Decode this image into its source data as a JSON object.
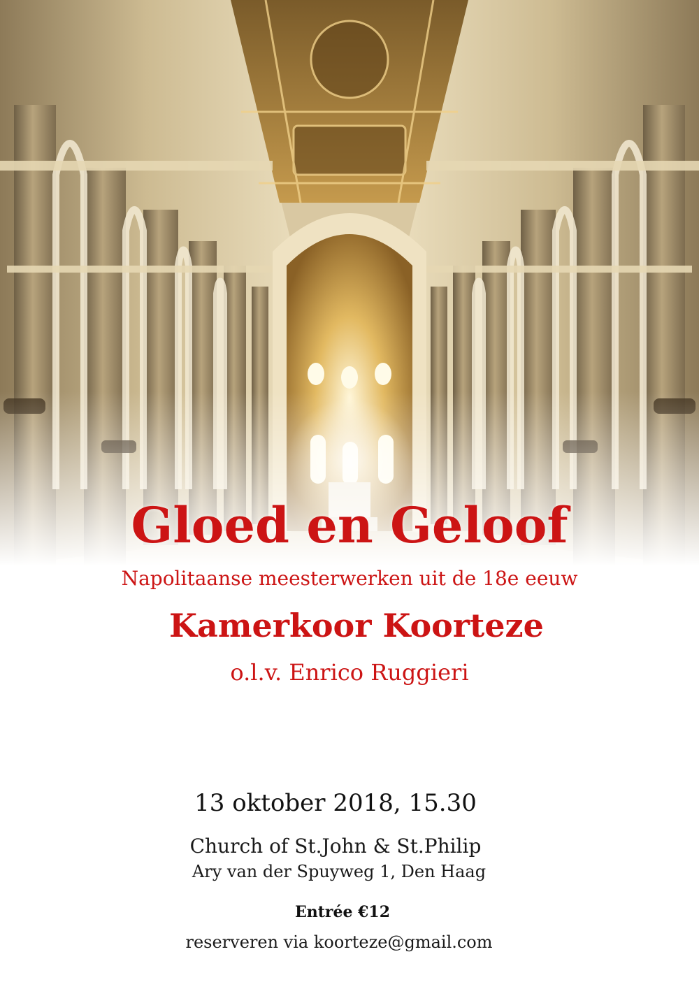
{
  "poster": {
    "photo_subject": "cathedral-nave-photo",
    "title": "Gloed en Geloof",
    "subtitle": "Napolitaanse meesterwerken uit de 18e eeuw",
    "choir": "Kamerkoor Koorteze",
    "conductor": "o.l.v. Enrico Ruggieri",
    "date": "13 oktober 2018, 15.30",
    "venue": "Church of St.John & St.Philip",
    "address": "Ary van der Spuyweg 1,  Den Haag",
    "entry": "Entrée €12",
    "reserve": "reserveren via koorteze@gmail.com"
  },
  "colors": {
    "accent_red": "#cc1414",
    "text_dark": "#111111",
    "background": "#ffffff",
    "stone": "#c9b58e",
    "gold": "#b8863c"
  }
}
